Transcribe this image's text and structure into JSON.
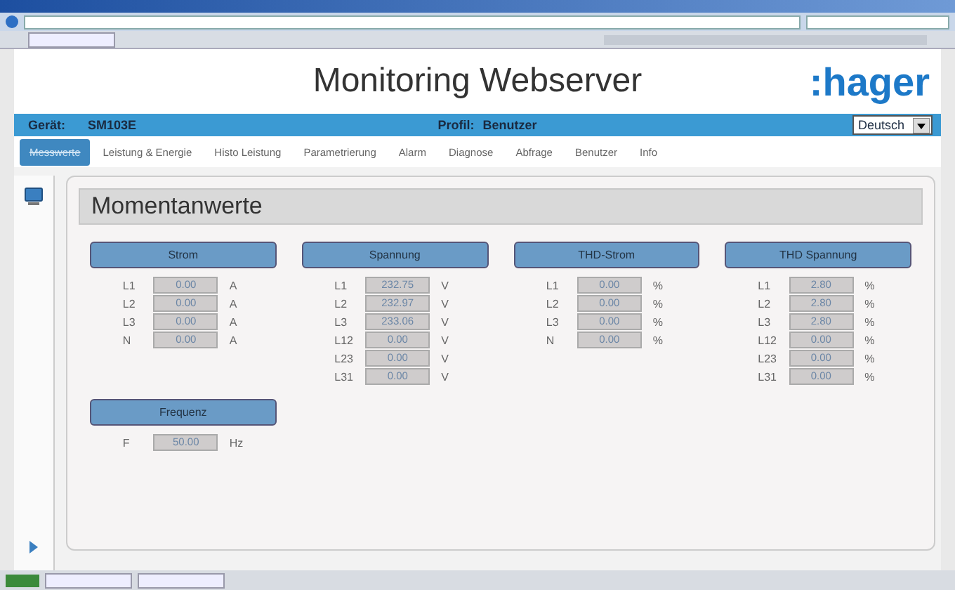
{
  "header": {
    "title": "Monitoring Webserver",
    "logo": ":hager"
  },
  "info_bar": {
    "device_label": "Gerät:",
    "device": "SM103E",
    "profile_label": "Profil:",
    "profile": "Benutzer",
    "language": "Deutsch"
  },
  "tabs": [
    {
      "label": "Messwerte",
      "selected": true
    },
    {
      "label": "Leistung & Energie",
      "selected": false
    },
    {
      "label": "Histo Leistung",
      "selected": false
    },
    {
      "label": "Parametrierung",
      "selected": false
    },
    {
      "label": "Alarm",
      "selected": false
    },
    {
      "label": "Diagnose",
      "selected": false
    },
    {
      "label": "Abfrage",
      "selected": false
    },
    {
      "label": "Benutzer",
      "selected": false
    },
    {
      "label": "Info",
      "selected": false
    }
  ],
  "section_title": "Momentanwerte",
  "groups": [
    {
      "title": "Strom",
      "rows": [
        {
          "label": "L1",
          "value": "0.00",
          "unit": "A"
        },
        {
          "label": "L2",
          "value": "0.00",
          "unit": "A"
        },
        {
          "label": "L3",
          "value": "0.00",
          "unit": "A"
        },
        {
          "label": "N",
          "value": "0.00",
          "unit": "A"
        }
      ]
    },
    {
      "title": "Spannung",
      "rows": [
        {
          "label": "L1",
          "value": "232.75",
          "unit": "V"
        },
        {
          "label": "L2",
          "value": "232.97",
          "unit": "V"
        },
        {
          "label": "L3",
          "value": "233.06",
          "unit": "V"
        },
        {
          "label": "L12",
          "value": "0.00",
          "unit": "V"
        },
        {
          "label": "L23",
          "value": "0.00",
          "unit": "V"
        },
        {
          "label": "L31",
          "value": "0.00",
          "unit": "V"
        }
      ]
    },
    {
      "title": "THD-Strom",
      "rows": [
        {
          "label": "L1",
          "value": "0.00",
          "unit": "%"
        },
        {
          "label": "L2",
          "value": "0.00",
          "unit": "%"
        },
        {
          "label": "L3",
          "value": "0.00",
          "unit": "%"
        },
        {
          "label": "N",
          "value": "0.00",
          "unit": "%"
        }
      ]
    },
    {
      "title": "THD Spannung",
      "rows": [
        {
          "label": "L1",
          "value": "2.80",
          "unit": "%"
        },
        {
          "label": "L2",
          "value": "2.80",
          "unit": "%"
        },
        {
          "label": "L3",
          "value": "2.80",
          "unit": "%"
        },
        {
          "label": "L12",
          "value": "0.00",
          "unit": "%"
        },
        {
          "label": "L23",
          "value": "0.00",
          "unit": "%"
        },
        {
          "label": "L31",
          "value": "0.00",
          "unit": "%"
        }
      ]
    },
    {
      "title": "Frequenz",
      "rows": [
        {
          "label": "F",
          "value": "50.00",
          "unit": "Hz"
        }
      ]
    }
  ]
}
